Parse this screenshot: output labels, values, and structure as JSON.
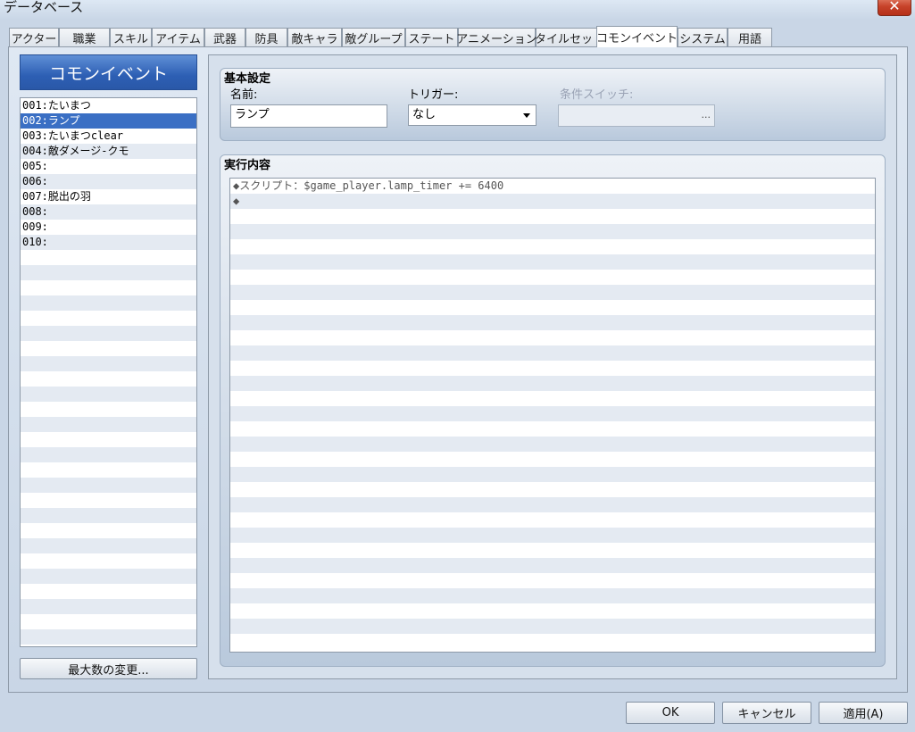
{
  "window": {
    "title": "データベース",
    "close_symbol": "✕"
  },
  "tabs": [
    "アクター",
    "職業",
    "スキル",
    "アイテム",
    "武器",
    "防具",
    "敵キャラ",
    "敵グループ",
    "ステート",
    "アニメーション",
    "タイルセット",
    "コモンイベント",
    "システム",
    "用語"
  ],
  "active_tab": "コモンイベント",
  "sidebar": {
    "header": "コモンイベント",
    "items": [
      "001:たいまつ",
      "002:ランプ",
      "003:たいまつclear",
      "004:敵ダメージ-クモ",
      "005:",
      "006:",
      "007:脱出の羽",
      "008:",
      "009:",
      "010:"
    ],
    "selected_index": 1,
    "max_button": "最大数の変更..."
  },
  "basic": {
    "title": "基本設定",
    "name_label": "名前:",
    "name_value": "ランプ",
    "trigger_label": "トリガー:",
    "trigger_value": "なし",
    "switch_label": "条件スイッチ:",
    "switch_button": "..."
  },
  "contents": {
    "title": "実行内容",
    "commands": [
      "◆スクリプト：$game_player.lamp_timer += 6400",
      "◆"
    ]
  },
  "footer": {
    "ok": "OK",
    "cancel": "キャンセル",
    "apply": "適用(A)"
  }
}
